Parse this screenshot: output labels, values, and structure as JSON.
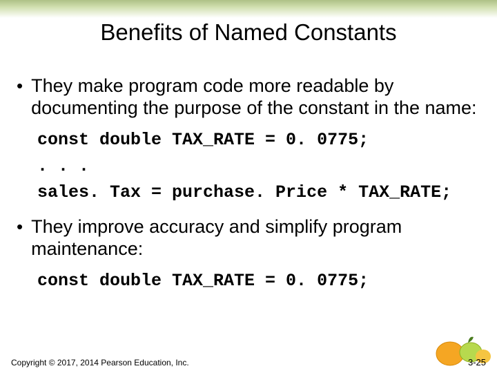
{
  "title": "Benefits of Named Constants",
  "bullets": [
    "They make program code more readable by documenting the purpose of the constant in the name:",
    "They improve accuracy and simplify program maintenance:"
  ],
  "code1": {
    "l1": "const double TAX_RATE = 0. 0775;",
    "l2": ". . .",
    "l3": "sales. Tax = purchase. Price * TAX_RATE;"
  },
  "code2": {
    "l1": "const double TAX_RATE = 0. 0775;"
  },
  "footer": {
    "copyright": "Copyright © 2017, 2014 Pearson Education, Inc.",
    "slide": "3-25"
  }
}
